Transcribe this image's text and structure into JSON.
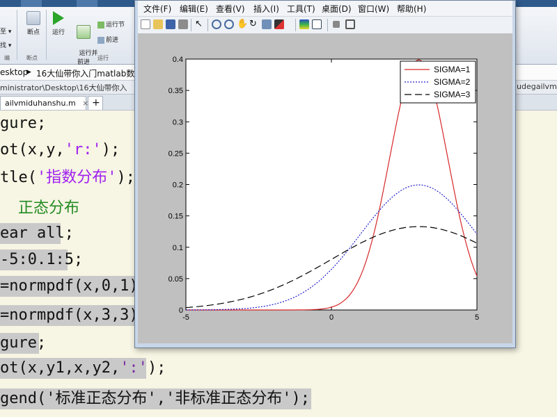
{
  "matlab": {
    "ribbon": {
      "left_items": [
        "至 ▾",
        "找 ▾"
      ],
      "breakpoints": "断点",
      "run": "运行",
      "run_advance": "运行并\n前进",
      "run_section": "运行节",
      "advance": "前进",
      "group_edit": "编",
      "group_breakpoints": "断点",
      "group_run": "运行"
    },
    "address": [
      "esktop",
      "▶",
      "16大仙带你入门matlab数"
    ],
    "path": "ministrator\\Desktop\\16大仙带你入",
    "path_right": "udegailvm",
    "tabs": [
      {
        "label": "ailvmiduhanshu.m",
        "close": "×"
      },
      {
        "label": "+"
      }
    ],
    "code_lines": [
      {
        "pre": "gure;",
        "str": "",
        "post": "",
        "selected": false
      },
      {
        "pre": "ot(x,y,",
        "str": "'r:'",
        "post": ");",
        "selected": false
      },
      {
        "pre": "tle(",
        "str": "'指数分布'",
        "post": ");",
        "selected": false
      },
      {
        "pre": "ear all;",
        "str": "",
        "post": "",
        "selected": true
      },
      {
        "pre": "-5:0.1:5;",
        "str": "",
        "post": "",
        "selected": true
      },
      {
        "pre": "=normpdf(x,0,1);",
        "str": "",
        "post": "",
        "selected": true
      },
      {
        "pre": "=normpdf(x,3,3);",
        "str": "",
        "post": "",
        "selected": true
      },
      {
        "pre": "gure;",
        "str": "",
        "post": "",
        "selected": true
      },
      {
        "pre": "ot(x,y1,x,y2,",
        "str": "':'",
        "post": ");",
        "selected": true
      },
      {
        "pre": "gend(",
        "str": "'标准正态分布','非标准正态分布'",
        "post": ");",
        "selected": true
      }
    ],
    "section_title": "正态分布"
  },
  "figure": {
    "menu": [
      "文件(F)",
      "编辑(E)",
      "查看(V)",
      "插入(I)",
      "工具(T)",
      "桌面(D)",
      "窗口(W)",
      "帮助(H)"
    ],
    "toolbar_icons": [
      "new-figure-icon",
      "open-icon",
      "save-icon",
      "print-icon",
      "pointer-icon",
      "zoom-in-icon",
      "zoom-out-icon",
      "pan-icon",
      "rotate-icon",
      "data-cursor-icon",
      "brush-icon",
      "colorbar-icon",
      "legend-icon",
      "hide-plot-tools-icon",
      "show-plot-tools-icon"
    ]
  },
  "chart_data": {
    "type": "line",
    "title": "",
    "xlabel": "",
    "ylabel": "",
    "xlim": [
      -5,
      5
    ],
    "ylim": [
      0,
      0.4
    ],
    "xticks": [
      "-5",
      "0",
      "5"
    ],
    "yticks": [
      "0",
      "0.05",
      "0.1",
      "0.15",
      "0.2",
      "0.25",
      "0.3",
      "0.35",
      "0.4"
    ],
    "legend_position": "top-right",
    "grid": false,
    "series": [
      {
        "name": "SIGMA=1",
        "mean": 3,
        "sigma": 1,
        "color": "#d62728",
        "dash": "solid"
      },
      {
        "name": "SIGMA=2",
        "mean": 3,
        "sigma": 2,
        "color": "#1f1fcf",
        "dash": "dotted"
      },
      {
        "name": "SIGMA=3",
        "mean": 3,
        "sigma": 3,
        "color": "#000000",
        "dash": "dashed"
      }
    ],
    "x_step": 0.1
  }
}
